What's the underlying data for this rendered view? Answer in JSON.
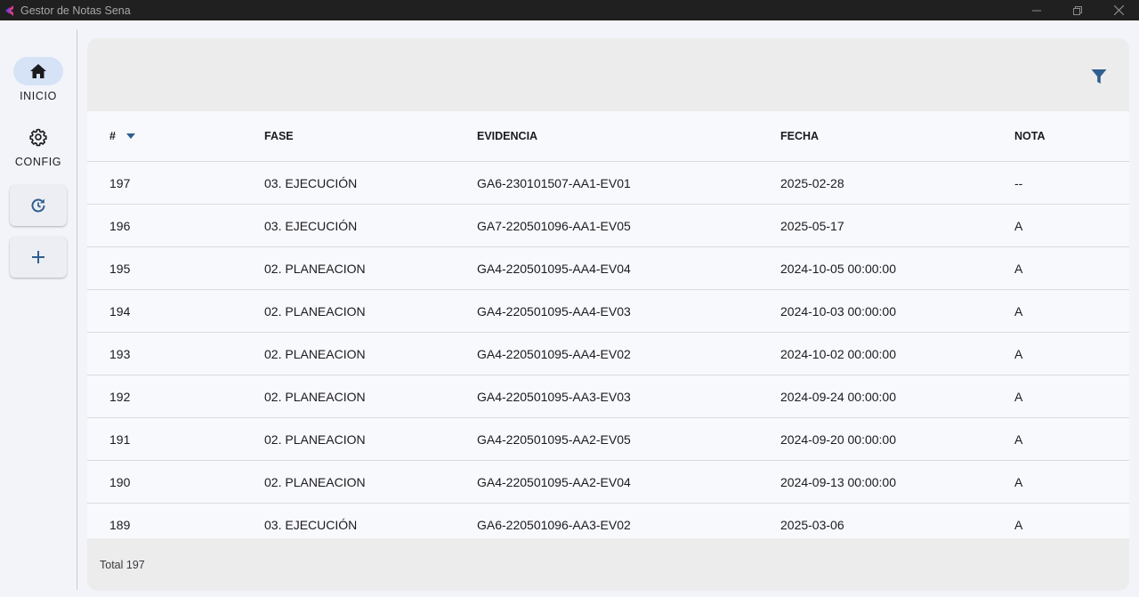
{
  "window": {
    "title": "Gestor de Notas Sena"
  },
  "sidebar": {
    "items": [
      {
        "label": "INICIO",
        "icon": "home-icon",
        "active": true
      },
      {
        "label": "CONFIG",
        "icon": "gear-icon",
        "active": false
      }
    ],
    "actions": [
      {
        "icon": "refresh-icon"
      },
      {
        "icon": "plus-icon"
      }
    ]
  },
  "table": {
    "headers": {
      "num": "#",
      "fase": "FASE",
      "evidencia": "EVIDENCIA",
      "fecha": "FECHA",
      "nota": "NOTA"
    },
    "rows": [
      {
        "num": "197",
        "fase": "03. EJECUCIÓN",
        "evidencia": "GA6-230101507-AA1-EV01",
        "fecha": "2025-02-28",
        "nota": "--"
      },
      {
        "num": "196",
        "fase": "03. EJECUCIÓN",
        "evidencia": "GA7-220501096-AA1-EV05",
        "fecha": "2025-05-17",
        "nota": "A"
      },
      {
        "num": "195",
        "fase": "02. PLANEACION",
        "evidencia": "GA4-220501095-AA4-EV04",
        "fecha": "2024-10-05 00:00:00",
        "nota": "A"
      },
      {
        "num": "194",
        "fase": "02. PLANEACION",
        "evidencia": "GA4-220501095-AA4-EV03",
        "fecha": "2024-10-03 00:00:00",
        "nota": "A"
      },
      {
        "num": "193",
        "fase": "02. PLANEACION",
        "evidencia": "GA4-220501095-AA4-EV02",
        "fecha": "2024-10-02 00:00:00",
        "nota": "A"
      },
      {
        "num": "192",
        "fase": "02. PLANEACION",
        "evidencia": "GA4-220501095-AA3-EV03",
        "fecha": "2024-09-24 00:00:00",
        "nota": "A"
      },
      {
        "num": "191",
        "fase": "02. PLANEACION",
        "evidencia": "GA4-220501095-AA2-EV05",
        "fecha": "2024-09-20 00:00:00",
        "nota": "A"
      },
      {
        "num": "190",
        "fase": "02. PLANEACION",
        "evidencia": "GA4-220501095-AA2-EV04",
        "fecha": "2024-09-13 00:00:00",
        "nota": "A"
      },
      {
        "num": "189",
        "fase": "03. EJECUCIÓN",
        "evidencia": "GA6-220501096-AA3-EV02",
        "fecha": "2025-03-06",
        "nota": "A"
      }
    ]
  },
  "footer": {
    "total": "Total 197"
  },
  "colors": {
    "accent": "#2f5f8f",
    "active_nav_bg": "#d6e3f7",
    "titlebar_bg": "#202020",
    "app_icon": "#e23a8c"
  }
}
